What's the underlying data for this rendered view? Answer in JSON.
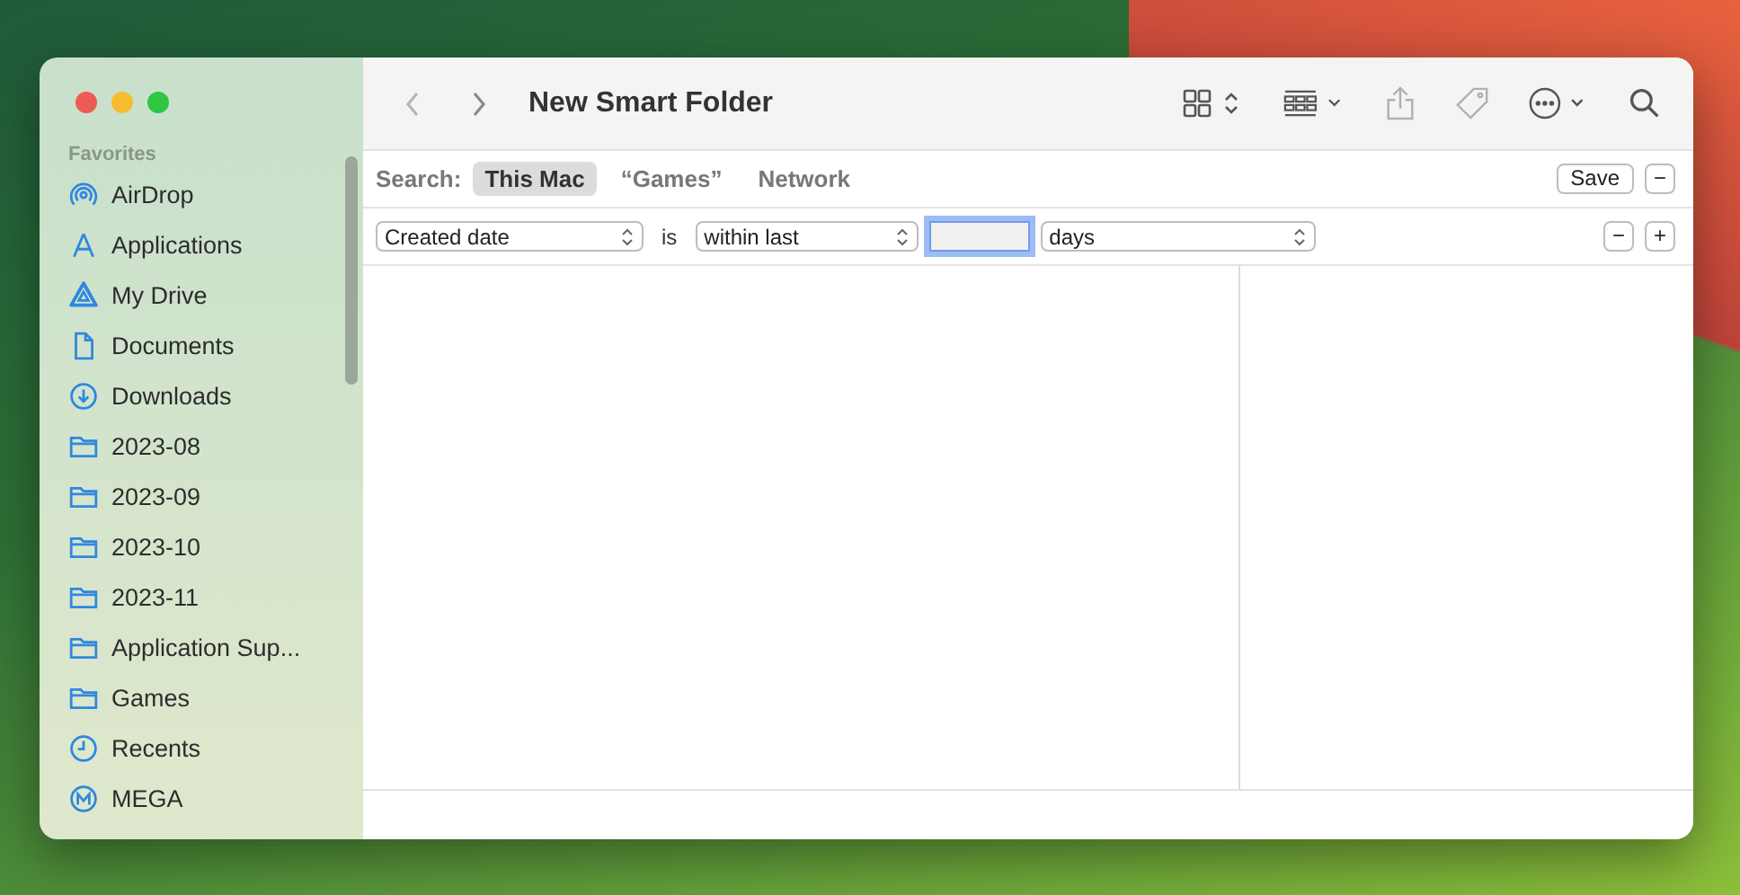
{
  "window": {
    "title": "New Smart Folder"
  },
  "sidebar": {
    "heading": "Favorites",
    "items": [
      {
        "label": "AirDrop",
        "kind": "airdrop"
      },
      {
        "label": "Applications",
        "kind": "apps"
      },
      {
        "label": "My Drive",
        "kind": "drive"
      },
      {
        "label": "Documents",
        "kind": "document"
      },
      {
        "label": "Downloads",
        "kind": "download"
      },
      {
        "label": "2023-08",
        "kind": "folder"
      },
      {
        "label": "2023-09",
        "kind": "folder"
      },
      {
        "label": "2023-10",
        "kind": "folder"
      },
      {
        "label": "2023-11",
        "kind": "folder"
      },
      {
        "label": "Application Sup...",
        "kind": "folder"
      },
      {
        "label": "Games",
        "kind": "folder"
      },
      {
        "label": "Recents",
        "kind": "clock"
      },
      {
        "label": "MEGA",
        "kind": "mega"
      }
    ]
  },
  "search": {
    "label": "Search:",
    "scopes": [
      {
        "label": "This Mac",
        "selected": true
      },
      {
        "label": "“Games”",
        "selected": false
      },
      {
        "label": "Network",
        "selected": false
      }
    ],
    "save": "Save",
    "remove": "−"
  },
  "criteria": {
    "attribute": "Created date",
    "is": "is",
    "operator": "within last",
    "focused": true,
    "unit": "days",
    "remove": "−",
    "add": "+"
  }
}
